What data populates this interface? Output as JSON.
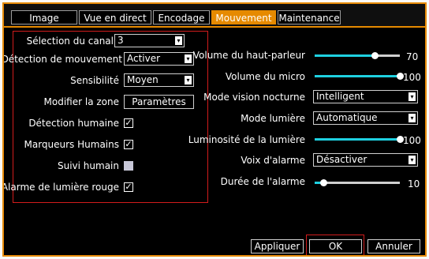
{
  "tabs": [
    {
      "label": "Image",
      "active": false
    },
    {
      "label": "Vue en direct",
      "active": false
    },
    {
      "label": "Encodage",
      "active": false
    },
    {
      "label": "Mouvement",
      "active": true
    },
    {
      "label": "Maintenance",
      "active": false
    }
  ],
  "left": {
    "channel": {
      "label": "Sélection du canal",
      "value": "3"
    },
    "motion": {
      "label": "Détection de mouvement",
      "value": "Activer"
    },
    "sensitivity": {
      "label": "Sensibilité",
      "value": "Moyen"
    },
    "zone": {
      "label": "Modifier la zone",
      "button": "Paramètres"
    },
    "human_detection": {
      "label": "Détection humaine",
      "checked": true
    },
    "human_markers": {
      "label": "Marqueurs Humains",
      "checked": true
    },
    "human_tracking": {
      "label": "Suivi humain",
      "checked": false
    },
    "red_light_alarm": {
      "label": "Alarme de lumière rouge",
      "checked": true
    }
  },
  "right": {
    "speaker_volume": {
      "label": "Volume du haut-parleur",
      "value": "70",
      "level": 0.7
    },
    "mic_volume": {
      "label": "Volume du micro",
      "value": "100",
      "level": 1.0
    },
    "night_vision": {
      "label": "Mode vision nocturne",
      "value": "Intelligent"
    },
    "light_mode": {
      "label": "Mode lumière",
      "value": "Automatique"
    },
    "light_brightness": {
      "label": "Luminosité de la lumière",
      "value": "100",
      "level": 1.0
    },
    "alarm_voice": {
      "label": "Voix d'alarme",
      "value": "Désactiver"
    },
    "alarm_duration": {
      "label": "Durée de l'alarme",
      "value": "10",
      "level": 0.1
    }
  },
  "buttons": {
    "apply": "Appliquer",
    "ok": "OK",
    "cancel": "Annuler"
  },
  "colors": {
    "accent": "#e68a00",
    "slider_fill": "#1ed0e0",
    "highlight_box": "#d21c1c"
  }
}
